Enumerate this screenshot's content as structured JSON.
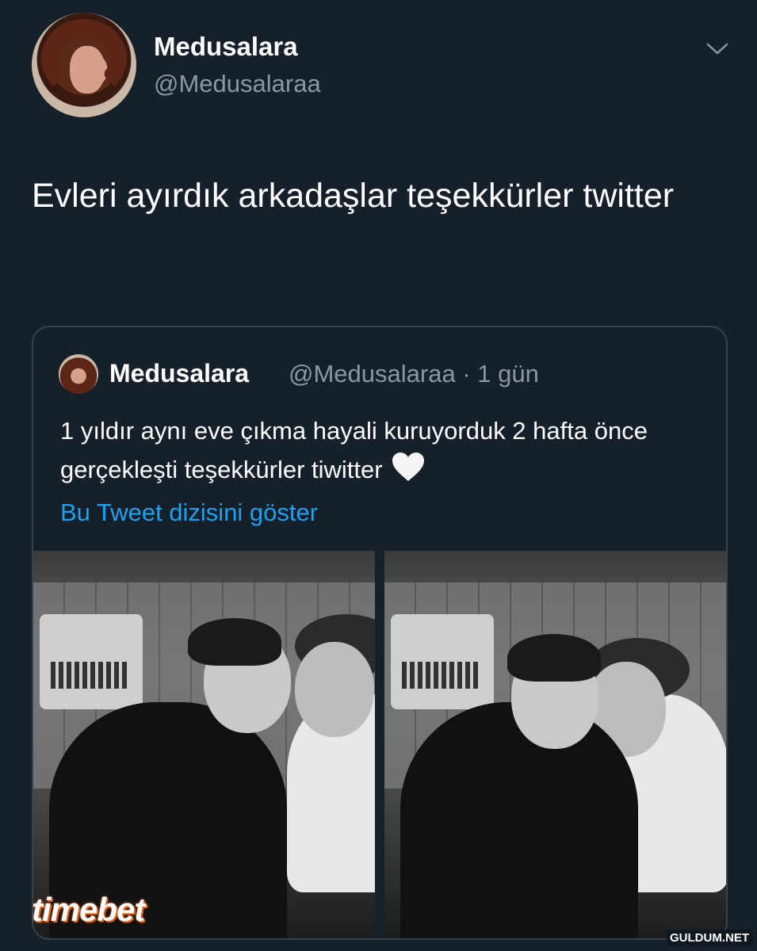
{
  "tweet": {
    "display_name": "Medusalara",
    "handle": "@Medusalaraa",
    "text": "Evleri ayırdık arkadaşlar teşekkürler twitter"
  },
  "quoted": {
    "display_name": "Medusalara",
    "meta": "@Medusalaraa · 1 gün",
    "text": "1 yıldır aynı eve çıkma hayali kuruyorduk 2 hafta önce gerçekleşti teşekkürler tiwitter",
    "emoji": "white-heart",
    "thread_link": "Bu Tweet dizisini göster",
    "photos": 2
  },
  "overlays": {
    "logo": "timebet",
    "site": "GULDUM.NET"
  },
  "colors": {
    "background": "#15202b",
    "secondary_text": "#8899a6",
    "link": "#1da1f2",
    "border": "#38444d"
  }
}
